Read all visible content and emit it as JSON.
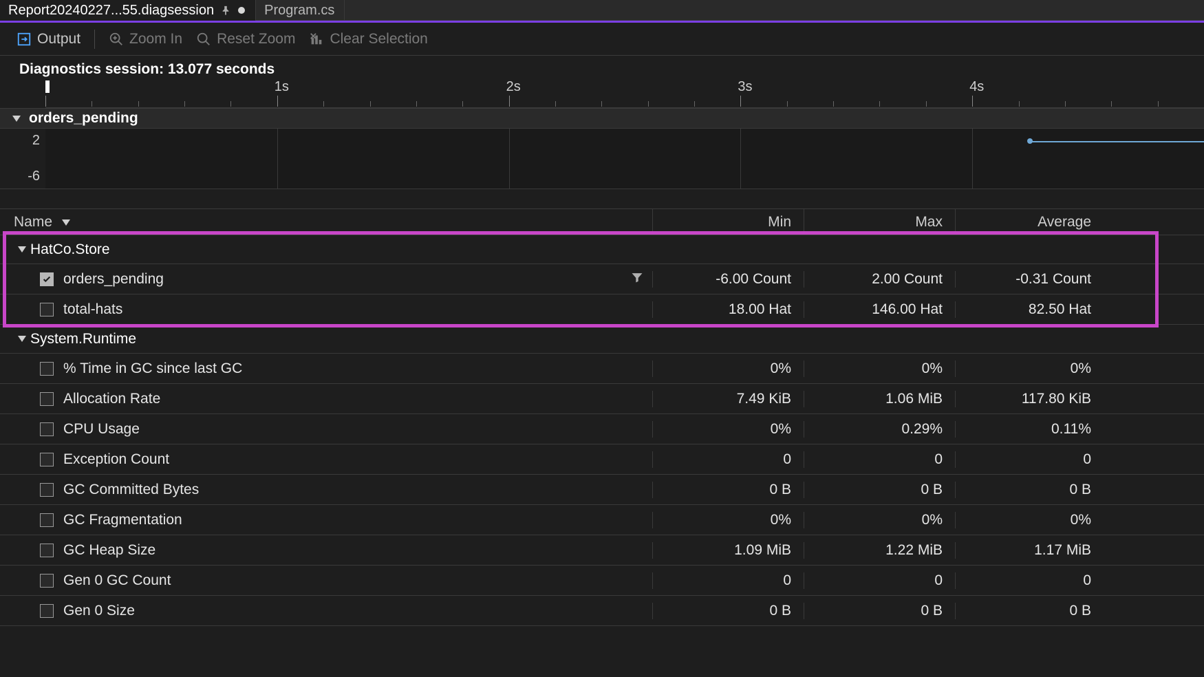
{
  "tabs": {
    "active": "Report20240227...55.diagsession",
    "other": "Program.cs"
  },
  "toolbar": {
    "output": "Output",
    "zoom_in": "Zoom In",
    "reset_zoom": "Reset Zoom",
    "clear_selection": "Clear Selection"
  },
  "session_label": "Diagnostics session: 13.077 seconds",
  "ruler_ticks": [
    "1s",
    "2s",
    "3s",
    "4s"
  ],
  "swimlane": {
    "title": "orders_pending",
    "y_top": "2",
    "y_bottom": "-6"
  },
  "columns": {
    "name": "Name",
    "min": "Min",
    "max": "Max",
    "avg": "Average"
  },
  "groups": [
    {
      "name": "HatCo.Store",
      "rows": [
        {
          "checked": true,
          "filter": true,
          "label": "orders_pending",
          "min": "-6.00 Count",
          "max": "2.00 Count",
          "avg": "-0.31 Count"
        },
        {
          "checked": false,
          "filter": false,
          "label": "total-hats",
          "min": "18.00 Hat",
          "max": "146.00 Hat",
          "avg": "82.50 Hat"
        }
      ]
    },
    {
      "name": "System.Runtime",
      "rows": [
        {
          "checked": false,
          "label": "% Time in GC since last GC",
          "min": "0%",
          "max": "0%",
          "avg": "0%"
        },
        {
          "checked": false,
          "label": "Allocation Rate",
          "min": "7.49 KiB",
          "max": "1.06 MiB",
          "avg": "117.80 KiB"
        },
        {
          "checked": false,
          "label": "CPU Usage",
          "min": "0%",
          "max": "0.29%",
          "avg": "0.11%"
        },
        {
          "checked": false,
          "label": "Exception Count",
          "min": "0",
          "max": "0",
          "avg": "0"
        },
        {
          "checked": false,
          "label": "GC Committed Bytes",
          "min": "0 B",
          "max": "0 B",
          "avg": "0 B"
        },
        {
          "checked": false,
          "label": "GC Fragmentation",
          "min": "0%",
          "max": "0%",
          "avg": "0%"
        },
        {
          "checked": false,
          "label": "GC Heap Size",
          "min": "1.09 MiB",
          "max": "1.22 MiB",
          "avg": "1.17 MiB"
        },
        {
          "checked": false,
          "label": "Gen 0 GC Count",
          "min": "0",
          "max": "0",
          "avg": "0"
        },
        {
          "checked": false,
          "label": "Gen 0 Size",
          "min": "0 B",
          "max": "0 B",
          "avg": "0 B"
        }
      ]
    }
  ],
  "chart_data": {
    "type": "line",
    "title": "orders_pending",
    "xlabel": "seconds",
    "ylabel": "Count",
    "ylim": [
      -6,
      2
    ],
    "x": [
      4.25,
      4.5,
      4.75,
      5.0
    ],
    "values": [
      2,
      2,
      2,
      2
    ]
  }
}
